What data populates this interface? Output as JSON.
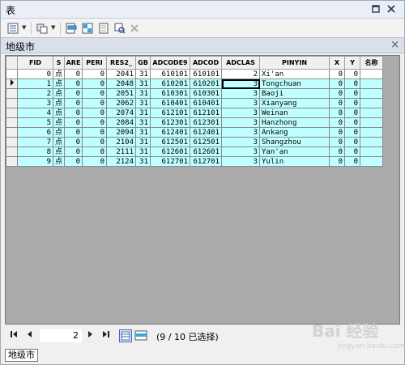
{
  "window": {
    "title": "表",
    "controls": [
      "restore-icon",
      "close-icon"
    ]
  },
  "toolbar": {
    "icons": [
      "table-options-icon",
      "related-tables-icon",
      "select-by-attributes-icon",
      "switch-selection-icon",
      "clear-selection-icon",
      "zoom-to-selected-icon",
      "delete-selected-icon"
    ]
  },
  "tab": {
    "label": "地级市",
    "close": "×"
  },
  "table": {
    "columns": [
      "FID",
      "S",
      "ARE",
      "PERI",
      "RES2_",
      "GB",
      "ADCODE9",
      "ADCOD",
      "ADCLAS",
      "PINYIN",
      "X",
      "Y",
      "名称"
    ],
    "rows": [
      {
        "selected": false,
        "current": false,
        "cells": [
          "0",
          "点",
          "0",
          "0",
          "2041",
          "31",
          "610101",
          "610101",
          "2",
          "Xi'an",
          "0",
          "0",
          ""
        ]
      },
      {
        "selected": true,
        "current": true,
        "cells": [
          "1",
          "点",
          "0",
          "0",
          "2048",
          "31",
          "610201",
          "610201",
          "3",
          "Tongchuan",
          "0",
          "0",
          ""
        ]
      },
      {
        "selected": true,
        "current": false,
        "cells": [
          "2",
          "点",
          "0",
          "0",
          "2051",
          "31",
          "610301",
          "610301",
          "3",
          "Baoji",
          "0",
          "0",
          ""
        ]
      },
      {
        "selected": true,
        "current": false,
        "cells": [
          "3",
          "点",
          "0",
          "0",
          "2062",
          "31",
          "610401",
          "610401",
          "3",
          "Xianyang",
          "0",
          "0",
          ""
        ]
      },
      {
        "selected": true,
        "current": false,
        "cells": [
          "4",
          "点",
          "0",
          "0",
          "2074",
          "31",
          "612101",
          "612101",
          "3",
          "Weinan",
          "0",
          "0",
          ""
        ]
      },
      {
        "selected": true,
        "current": false,
        "cells": [
          "5",
          "点",
          "0",
          "0",
          "2084",
          "31",
          "612301",
          "612301",
          "3",
          "Hanzhong",
          "0",
          "0",
          ""
        ]
      },
      {
        "selected": true,
        "current": false,
        "cells": [
          "6",
          "点",
          "0",
          "0",
          "2094",
          "31",
          "612401",
          "612401",
          "3",
          "Ankang",
          "0",
          "0",
          ""
        ]
      },
      {
        "selected": true,
        "current": false,
        "cells": [
          "7",
          "点",
          "0",
          "0",
          "2104",
          "31",
          "612501",
          "612501",
          "3",
          "Shangzhou",
          "0",
          "0",
          ""
        ]
      },
      {
        "selected": true,
        "current": false,
        "cells": [
          "8",
          "点",
          "0",
          "0",
          "2111",
          "31",
          "612601",
          "612601",
          "3",
          "Yan'an",
          "0",
          "0",
          ""
        ]
      },
      {
        "selected": true,
        "current": false,
        "cells": [
          "9",
          "点",
          "0",
          "0",
          "2124",
          "31",
          "612701",
          "612701",
          "3",
          "Yulin",
          "0",
          "0",
          ""
        ]
      }
    ]
  },
  "pager": {
    "current_record": "2",
    "selection_info": "(9 / 10 已选择)"
  },
  "bottom_tab": {
    "label": "地级市"
  },
  "watermark": {
    "text": "Bai 经验",
    "sub": "jingyan.baidu.com"
  },
  "colors": {
    "selected_row": "#bfffff",
    "grid_background": "#aaaaaa"
  }
}
